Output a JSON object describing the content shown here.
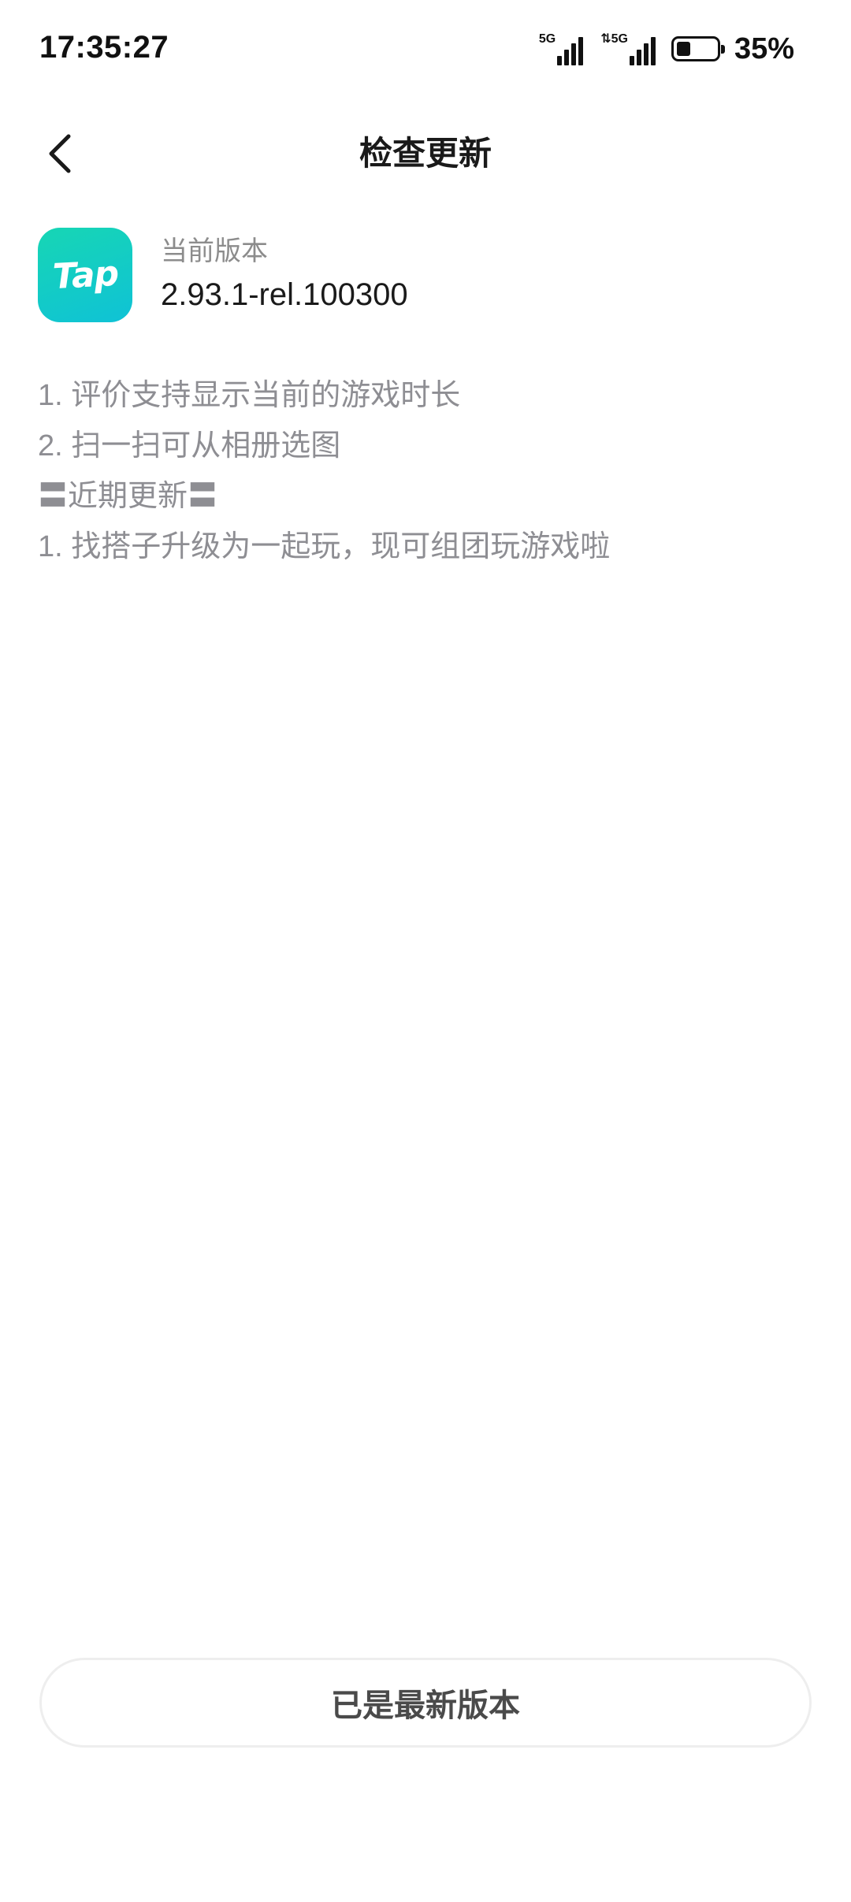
{
  "status_bar": {
    "time": "17:35:27",
    "signal1_label": "5G",
    "signal2_label": "⇅5G",
    "battery_percent": "35%",
    "battery_level": 0.35
  },
  "header": {
    "title": "检查更新",
    "back_icon": "chevron-left-icon"
  },
  "app": {
    "icon_text": "Tap",
    "version_label": "当前版本",
    "version_value": "2.93.1-rel.100300",
    "icon_color_start": "#17d6b4",
    "icon_color_end": "#0fc2d6"
  },
  "changelog": {
    "lines": [
      "1. 评价支持显示当前的游戏时长",
      "2. 扫一扫可从相册选图",
      "〓近期更新〓",
      "1. 找搭子升级为一起玩，现可组团玩游戏啦"
    ]
  },
  "footer": {
    "button_label": "已是最新版本"
  }
}
